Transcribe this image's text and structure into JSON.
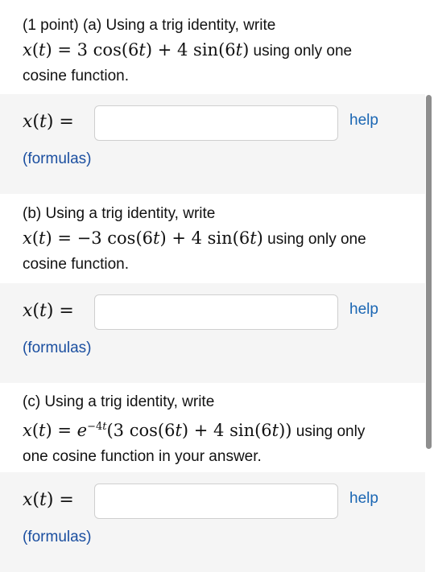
{
  "part_a": {
    "intro": "(1 point) (a) Using a trig identity, write",
    "suffix": " using only one",
    "line3": "cosine function.",
    "label": "x(t) =",
    "help": "help",
    "formulas": "(formulas)"
  },
  "part_b": {
    "intro": "(b) Using a trig identity, write",
    "suffix": " using only one",
    "line3": "cosine function.",
    "label": "x(t) =",
    "help": "help",
    "formulas": "(formulas)"
  },
  "part_c": {
    "intro": "(c) Using a trig identity, write",
    "suffix": " using only",
    "line3": "one cosine function in your answer.",
    "label": "x(t) =",
    "help": "help",
    "formulas": "(formulas)"
  }
}
